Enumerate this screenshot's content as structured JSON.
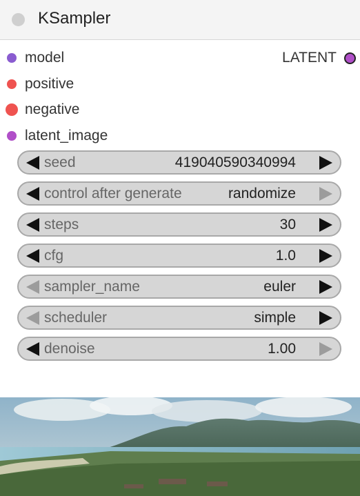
{
  "node": {
    "title": "KSampler",
    "inputs": [
      {
        "label": "model",
        "color": "#8a5cd0"
      },
      {
        "label": "positive",
        "color": "#ef5350"
      },
      {
        "label": "negative",
        "color": "#ef5350"
      },
      {
        "label": "latent_image",
        "color": "#b04fc8"
      }
    ],
    "output": {
      "label": "LATENT",
      "color": "#b04fc8"
    },
    "widgets": [
      {
        "label": "seed",
        "value": "419040590340994"
      },
      {
        "label": "control after generate",
        "value": "randomize"
      },
      {
        "label": "steps",
        "value": "30"
      },
      {
        "label": "cfg",
        "value": "1.0"
      },
      {
        "label": "sampler_name",
        "value": "euler"
      },
      {
        "label": "scheduler",
        "value": "simple"
      },
      {
        "label": "denoise",
        "value": "1.00"
      }
    ]
  },
  "preview": {
    "icon": "image-preview"
  }
}
